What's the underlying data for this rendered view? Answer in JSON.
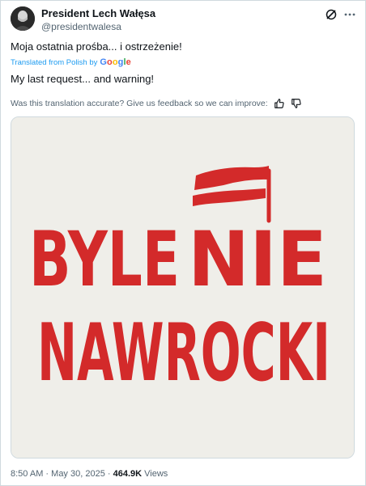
{
  "author": {
    "display_name": "President Lech Wałęsa",
    "handle": "@presidentwalesa"
  },
  "tweet": {
    "original_text": "Moja ostatnia prośba... i ostrzeżenie!",
    "translated_from": "Translated from Polish by",
    "translator_logo": [
      "G",
      "o",
      "o",
      "g",
      "l",
      "e"
    ],
    "translation_text": "My last request... and warning!",
    "feedback_prompt": "Was this translation accurate? Give us feedback so we can improve:"
  },
  "image": {
    "line1_left": "BYLE",
    "line1_right": "NIE",
    "line2": "NAWROCKI",
    "accent_color": "#d32a2a",
    "background_color": "#efeee9"
  },
  "meta": {
    "time": "8:50 AM",
    "separator": "·",
    "date": "May 30, 2025",
    "views_count": "464.9K",
    "views_label": "Views"
  },
  "icons": {
    "grok": "grok-icon",
    "more": "more-icon",
    "thumbs_up": "thumbs-up-icon",
    "thumbs_down": "thumbs-down-icon"
  },
  "colors": {
    "link_blue": "#1d9bf0",
    "secondary_text": "#536471",
    "google_blue": "#4285f4",
    "google_red": "#ea4335",
    "google_yellow": "#fbbc05",
    "google_green": "#34a853"
  }
}
